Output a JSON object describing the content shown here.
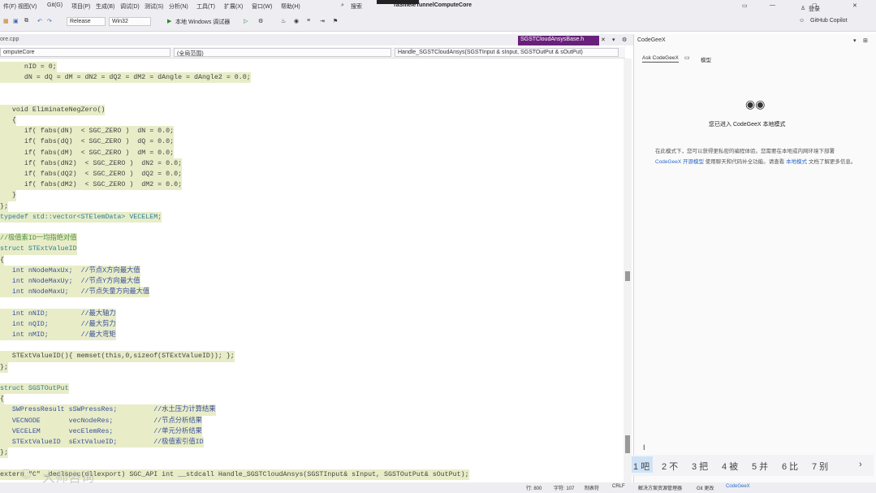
{
  "menubar": {
    "items": [
      "件(F)",
      "视图(V)",
      "Git(G)",
      "项目(P)",
      "生成(B)",
      "调试(D)",
      "测试(S)",
      "分析(N)",
      "工具(T)",
      "扩展(X)",
      "窗口(W)",
      "帮助(H)"
    ],
    "search_label": "搜索",
    "window_title": "TaSmeleTunnelComputeCore",
    "login_label": "登录"
  },
  "toolbar": {
    "config": "Release",
    "platform": "Win32",
    "run_label": "本地 Windows 调试器",
    "copilot_label": "GitHub Copilot"
  },
  "tabs": {
    "left_tab": "ore.cpp",
    "active_tab": "SGSTCloudAnsysBase.h"
  },
  "navbar": {
    "project": "omputeCore",
    "scope": "(全局范围)",
    "member": "Handle_SGSTCloudAnsys(SGSTInput & sInput, SGSTOutPut & sOutPut)"
  },
  "code_lines": [
    {
      "text": "      nID = 0;",
      "sel": true,
      "kind": "plain"
    },
    {
      "text": "      dN = dQ = dM = dN2 = dQ2 = dM2 = dAngle = dAngle2 = 0.0;",
      "sel": true,
      "kind": "plain"
    },
    {
      "text": "",
      "sel": false,
      "kind": "plain"
    },
    {
      "text": "",
      "sel": false,
      "kind": "plain"
    },
    {
      "text": "   void EliminateNegZero()",
      "sel": true,
      "kind": "plain"
    },
    {
      "text": "   {",
      "sel": true,
      "kind": "plain"
    },
    {
      "text": "      if( fabs(dN)  < SGC_ZERO )  dN = 0.0;",
      "sel": true,
      "kind": "plain"
    },
    {
      "text": "      if( fabs(dQ)  < SGC_ZERO )  dQ = 0.0;",
      "sel": true,
      "kind": "plain"
    },
    {
      "text": "      if( fabs(dM)  < SGC_ZERO )  dM = 0.0;",
      "sel": true,
      "kind": "plain"
    },
    {
      "text": "      if( fabs(dN2)  < SGC_ZERO )  dN2 = 0.0;",
      "sel": true,
      "kind": "plain"
    },
    {
      "text": "      if( fabs(dQ2)  < SGC_ZERO )  dQ2 = 0.0;",
      "sel": true,
      "kind": "plain"
    },
    {
      "text": "      if( fabs(dM2)  < SGC_ZERO )  dM2 = 0.0;",
      "sel": true,
      "kind": "plain"
    },
    {
      "text": "   }",
      "sel": true,
      "kind": "plain"
    },
    {
      "text": "};",
      "sel": true,
      "kind": "plain"
    },
    {
      "text": "typedef std::vector<STElemData> VECELEM;",
      "sel": true,
      "kind": "type"
    },
    {
      "text": "",
      "sel": false,
      "kind": "plain"
    },
    {
      "text": "//极值索ID一均指绝对值",
      "sel": true,
      "kind": "comment"
    },
    {
      "text": "struct STExtValueID",
      "sel": true,
      "kind": "type"
    },
    {
      "text": "{",
      "sel": true,
      "kind": "plain"
    },
    {
      "text": "   int nNodeMaxUx;  //节点X方向最大值",
      "sel": true,
      "kind": "member"
    },
    {
      "text": "   int nNodeMaxUy;  //节点Y方向最大值",
      "sel": true,
      "kind": "member"
    },
    {
      "text": "   int nNodeMaxU;   //节点矢量方向最大值",
      "sel": true,
      "kind": "member"
    },
    {
      "text": "",
      "sel": false,
      "kind": "plain"
    },
    {
      "text": "   int nNID;        //最大轴力",
      "sel": true,
      "kind": "member"
    },
    {
      "text": "   int nQID;        //最大剪力",
      "sel": true,
      "kind": "member"
    },
    {
      "text": "   int nMID;        //最大弯矩",
      "sel": true,
      "kind": "member"
    },
    {
      "text": "",
      "sel": false,
      "kind": "plain"
    },
    {
      "text": "   STExtValueID(){ memset(this,0,sizeof(STExtValueID)); };",
      "sel": true,
      "kind": "plain"
    },
    {
      "text": "};",
      "sel": true,
      "kind": "plain"
    },
    {
      "text": "",
      "sel": false,
      "kind": "plain"
    },
    {
      "text": "struct SGSTOutPut",
      "sel": true,
      "kind": "type"
    },
    {
      "text": "{",
      "sel": true,
      "kind": "plain"
    },
    {
      "text": "   SWPressResult sSWPressRes;         //水土压力计算结果",
      "sel": true,
      "kind": "member"
    },
    {
      "text": "   VECNODE       vecNodeRes;          //节点分析结果",
      "sel": true,
      "kind": "member"
    },
    {
      "text": "   VECELEM       vecElemRes;          //单元分析结果",
      "sel": true,
      "kind": "member"
    },
    {
      "text": "   STExtValueID  sExtValueID;         //极值索引值ID",
      "sel": true,
      "kind": "member"
    },
    {
      "text": "};",
      "sel": true,
      "kind": "plain"
    },
    {
      "text": "",
      "sel": false,
      "kind": "plain"
    },
    {
      "text": "extern \"C\" _declspec(dllexport) SGC_API int __stdcall Handle_SGSTCloudAnsys(SGSTInput& sInput, SGSTOutPut& sOutPut);",
      "sel": true,
      "kind": "plain"
    }
  ],
  "codegeex": {
    "panel_title": "CodeGeeX",
    "tab_ask": "Ask CodeGeeX",
    "tab_model": "模型",
    "heading": "您已进入 CodeGeeX 本地模式",
    "body_1": "在此模式下，您可以获得更私密的编程体验。您需要在本地或内网环境下部署",
    "link_1": "CodeGeeX 开源模型",
    "body_2": "使用聊天和代码补全功能。请查看",
    "link_2": "本地模式",
    "body_3": "文档了解更多信息。"
  },
  "ime": {
    "candidates": [
      "1 吧",
      "2 不",
      "3 把",
      "4 被",
      "5 并",
      "6 比",
      "7 别"
    ]
  },
  "statusbar": {
    "items": [
      "行: 800",
      "字符: 107",
      "制表符",
      "CRLF",
      "解决方案资源管理器",
      "Git 更改",
      "CodeGeeX"
    ]
  },
  "watermark": "大师咨询"
}
